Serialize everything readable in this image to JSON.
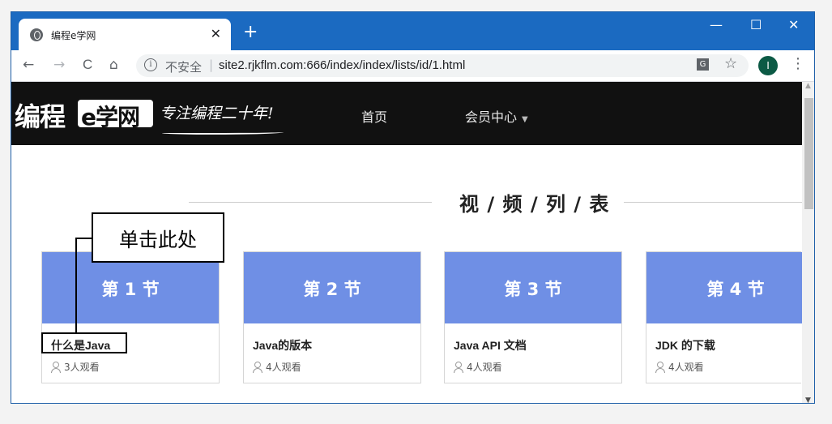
{
  "browser": {
    "tab_title": "编程e学网",
    "new_tab": "+",
    "close_tab": "✕",
    "window_controls": {
      "minimize": "—",
      "maximize": "☐",
      "close": "✕"
    },
    "nav": {
      "back": "←",
      "forward": "→",
      "reload": "C",
      "home": "⌂"
    },
    "address": {
      "info_icon": "i",
      "security_label": "不安全",
      "separator": "|",
      "url": "site2.rjkflm.com:666/index/index/lists/id/1.html"
    },
    "profile_initial": "I",
    "menu": "⋮",
    "star": "☆",
    "translate": "G",
    "scroll_up": "▲",
    "scroll_down": "▼"
  },
  "site": {
    "logo_text": "编程",
    "logo_badge": "e学网",
    "slogan": "专注编程二十年!",
    "nav": [
      {
        "label": "首页"
      },
      {
        "label": "会员中心",
        "caret": "▼"
      }
    ],
    "section_title": "视 / 频 / 列 / 表",
    "cards": [
      {
        "section": "第 1 节",
        "title": "什么是Java",
        "views": "3人观看"
      },
      {
        "section": "第 2 节",
        "title": "Java的版本",
        "views": "4人观看"
      },
      {
        "section": "第 3 节",
        "title": "Java API 文档",
        "views": "4人观看"
      },
      {
        "section": "第 4 节",
        "title": "JDK 的下载",
        "views": "4人观看"
      }
    ],
    "colors": {
      "banner": "#6f8fe5",
      "header_bg": "#111111",
      "tabstrip": "#1b6ac1"
    }
  },
  "annotation": {
    "callout_text": "单击此处"
  }
}
